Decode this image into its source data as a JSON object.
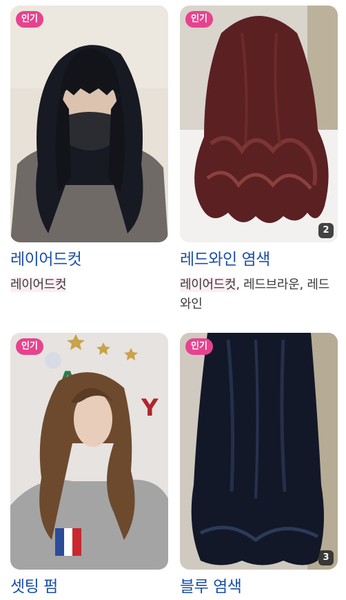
{
  "cards": [
    {
      "badge": "인기",
      "title": "레이어드컷",
      "tags": [
        "레이어드컷"
      ]
    },
    {
      "badge": "인기",
      "title": "레드와인 염색",
      "count": "2",
      "tags": [
        "레이어드컷",
        "레드브라운",
        "레드와인"
      ],
      "tag_separator": ", "
    },
    {
      "badge": "인기",
      "title": "셋팅 펌"
    },
    {
      "badge": "인기",
      "title": "블루 염색",
      "count": "3"
    }
  ],
  "photos": {
    "layered_cut": "woman-black-layered-hair-mask-photo",
    "red_wine": "red-wine-wavy-hair-photo",
    "setting_perm": "brown-wavy-perm-hoodie-photo",
    "blue": "dark-blue-straight-hair-photo"
  }
}
